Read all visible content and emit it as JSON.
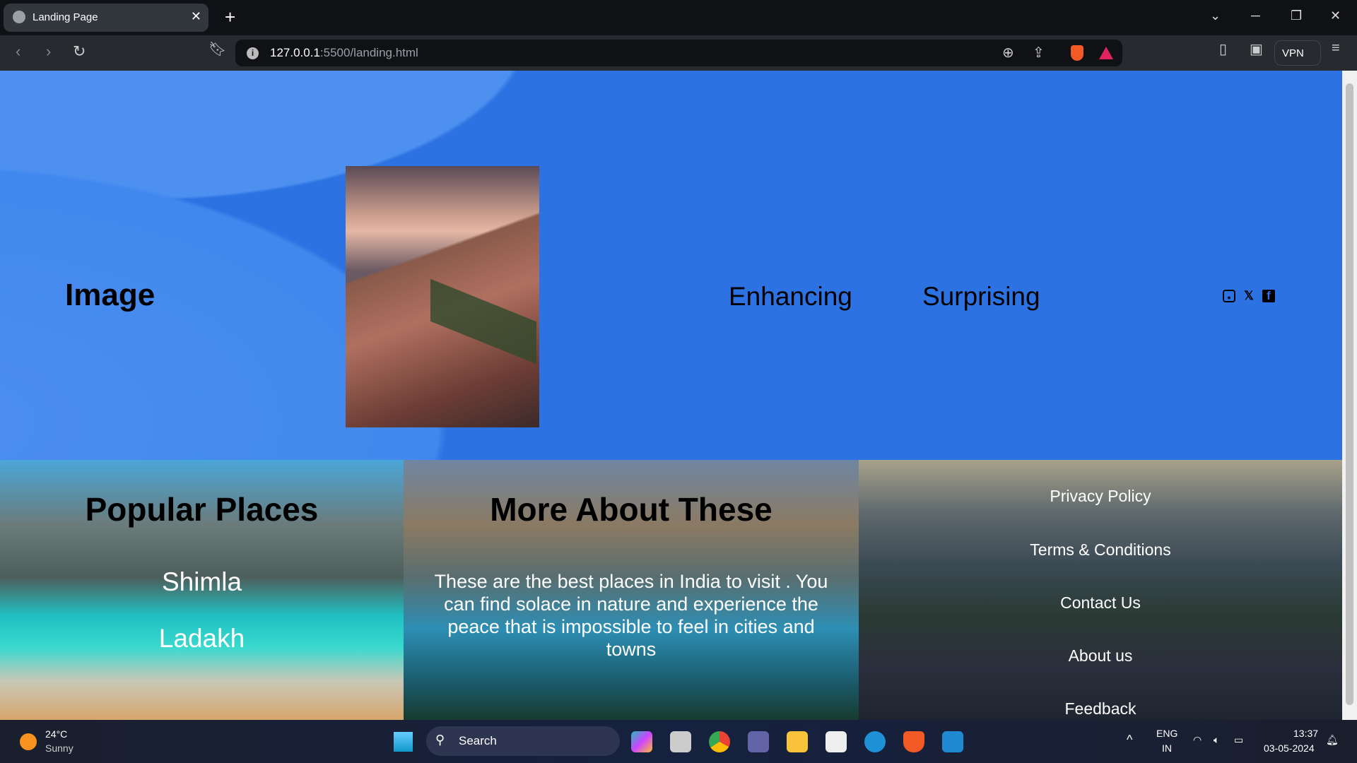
{
  "browser": {
    "tab_title": "Landing Page",
    "url_host": "127.0.0.1",
    "url_rest": ":5500/landing.html",
    "vpn_label": "VPN"
  },
  "hero": {
    "image_label": "Image",
    "nav": [
      "Enhancing",
      "Surprising"
    ],
    "social": [
      "instagram",
      "x",
      "facebook"
    ]
  },
  "popular": {
    "title": "Popular Places",
    "places": [
      "Shimla",
      "Ladakh"
    ]
  },
  "more": {
    "title": "More About These",
    "text": "These are the best places in India to visit . You can find solace in nature and experience the peace that is impossible to feel in cities and towns"
  },
  "footer": {
    "links": [
      "Privacy Policy",
      "Terms & Conditions",
      "Contact Us",
      "About us",
      "Feedback"
    ]
  },
  "taskbar": {
    "temp": "24°C",
    "weather": "Sunny",
    "search": "Search",
    "lang1": "ENG",
    "lang2": "IN",
    "time": "13:37",
    "date": "03-05-2024"
  }
}
